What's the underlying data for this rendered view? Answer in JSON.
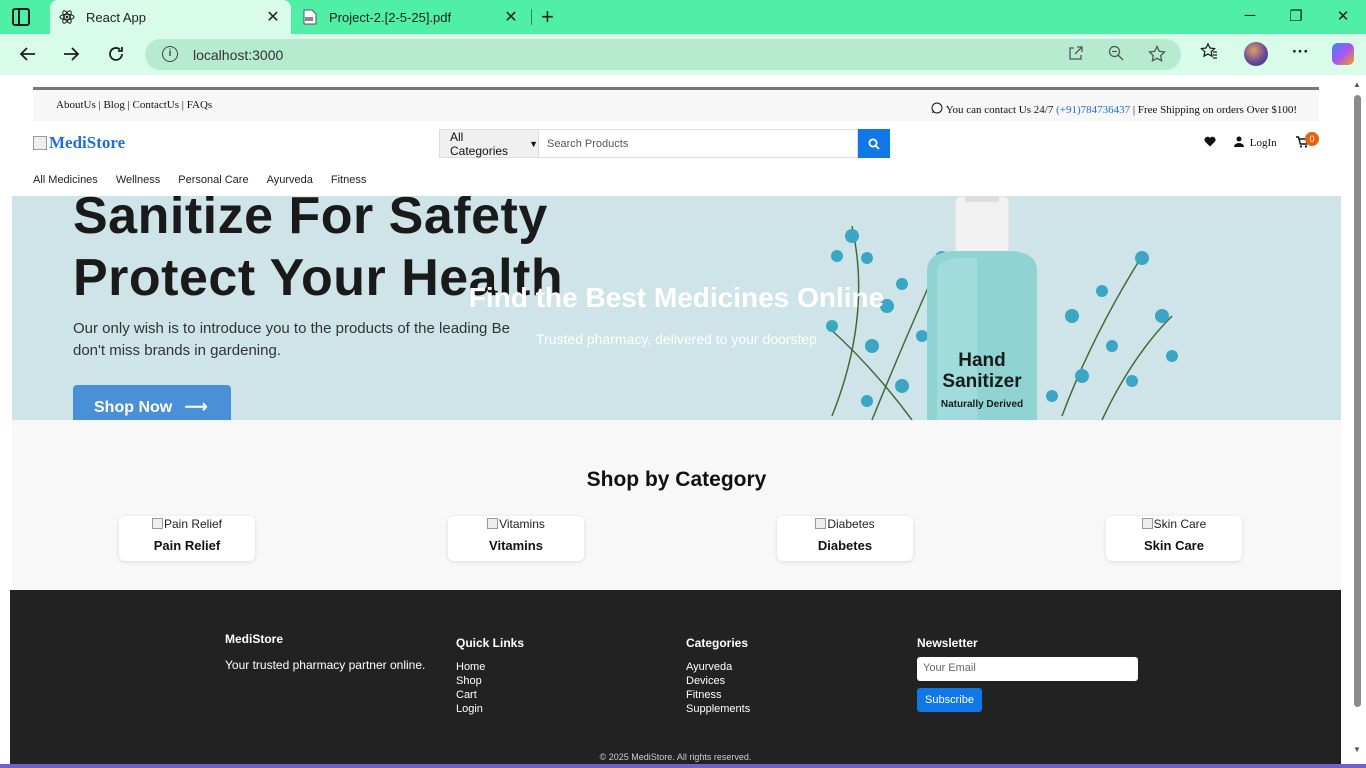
{
  "browser": {
    "tabs": [
      {
        "title": "React App",
        "active": true
      },
      {
        "title": "Project-2.[2-5-25].pdf",
        "active": false
      }
    ],
    "url": "localhost:3000"
  },
  "topbar": {
    "links": [
      "AboutUs",
      "Blog",
      "ContactUs",
      "FAQs"
    ],
    "contact_prefix": "You can contact Us 24/7 ",
    "phone": "(+91)784736437",
    "shipping": " | Free Shipping on orders Over $100!"
  },
  "header": {
    "logo": "MediStore",
    "category_select": "All Categories",
    "search_placeholder": "Search Products",
    "login": "LogIn",
    "cart_count": "0"
  },
  "nav": {
    "items": [
      "All Medicines",
      "Wellness",
      "Personal Care",
      "Ayurveda",
      "Fitness"
    ]
  },
  "hero": {
    "banner_line1": "Sanitize For Safety",
    "banner_line2": "Protect Your Health",
    "banner_sub1": "Our only wish is to introduce you to the products of the leading Be",
    "banner_sub2": "don't miss brands in gardening.",
    "banner_button": "Shop Now",
    "bottle_text1": "Hand",
    "bottle_text2": "Sanitizer",
    "bottle_text3": "Naturally Derived",
    "title": "Find the Best Medicines Online",
    "subtitle": "Trusted pharmacy, delivered to your doorstep"
  },
  "categories": {
    "heading": "Shop by Category",
    "items": [
      {
        "alt": "Pain Relief",
        "name": "Pain Relief"
      },
      {
        "alt": "Vitamins",
        "name": "Vitamins"
      },
      {
        "alt": "Diabetes",
        "name": "Diabetes"
      },
      {
        "alt": "Skin Care",
        "name": "Skin Care"
      }
    ]
  },
  "footer": {
    "brand": "MediStore",
    "tagline": "Your trusted pharmacy partner online.",
    "quick_links_title": "Quick Links",
    "quick_links": [
      "Home",
      "Shop",
      "Cart",
      "Login"
    ],
    "categories_title": "Categories",
    "categories": [
      "Ayurveda",
      "Devices",
      "Fitness",
      "Supplements"
    ],
    "newsletter_title": "Newsletter",
    "email_placeholder": "Your Email",
    "subscribe": "Subscribe",
    "copyright": "© 2025 MediStore. All rights reserved."
  },
  "colors": {
    "tab_bar": "#4ff0a6",
    "accent": "#1077e6",
    "footer_bg": "#222222",
    "hero_bg": "#cfe4e8",
    "cart_badge": "#e8620c"
  }
}
